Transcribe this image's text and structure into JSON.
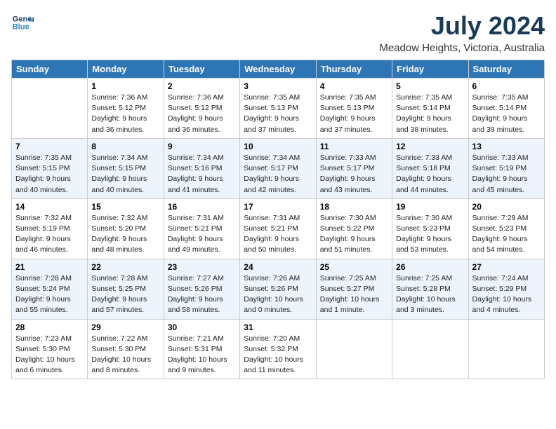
{
  "header": {
    "logo_line1": "General",
    "logo_line2": "Blue",
    "month_year": "July 2024",
    "location": "Meadow Heights, Victoria, Australia"
  },
  "weekdays": [
    "Sunday",
    "Monday",
    "Tuesday",
    "Wednesday",
    "Thursday",
    "Friday",
    "Saturday"
  ],
  "weeks": [
    [
      {
        "day": "",
        "sunrise": "",
        "sunset": "",
        "daylight": ""
      },
      {
        "day": "1",
        "sunrise": "Sunrise: 7:36 AM",
        "sunset": "Sunset: 5:12 PM",
        "daylight": "Daylight: 9 hours and 36 minutes."
      },
      {
        "day": "2",
        "sunrise": "Sunrise: 7:36 AM",
        "sunset": "Sunset: 5:12 PM",
        "daylight": "Daylight: 9 hours and 36 minutes."
      },
      {
        "day": "3",
        "sunrise": "Sunrise: 7:35 AM",
        "sunset": "Sunset: 5:13 PM",
        "daylight": "Daylight: 9 hours and 37 minutes."
      },
      {
        "day": "4",
        "sunrise": "Sunrise: 7:35 AM",
        "sunset": "Sunset: 5:13 PM",
        "daylight": "Daylight: 9 hours and 37 minutes."
      },
      {
        "day": "5",
        "sunrise": "Sunrise: 7:35 AM",
        "sunset": "Sunset: 5:14 PM",
        "daylight": "Daylight: 9 hours and 38 minutes."
      },
      {
        "day": "6",
        "sunrise": "Sunrise: 7:35 AM",
        "sunset": "Sunset: 5:14 PM",
        "daylight": "Daylight: 9 hours and 39 minutes."
      }
    ],
    [
      {
        "day": "7",
        "sunrise": "Sunrise: 7:35 AM",
        "sunset": "Sunset: 5:15 PM",
        "daylight": "Daylight: 9 hours and 40 minutes."
      },
      {
        "day": "8",
        "sunrise": "Sunrise: 7:34 AM",
        "sunset": "Sunset: 5:15 PM",
        "daylight": "Daylight: 9 hours and 40 minutes."
      },
      {
        "day": "9",
        "sunrise": "Sunrise: 7:34 AM",
        "sunset": "Sunset: 5:16 PM",
        "daylight": "Daylight: 9 hours and 41 minutes."
      },
      {
        "day": "10",
        "sunrise": "Sunrise: 7:34 AM",
        "sunset": "Sunset: 5:17 PM",
        "daylight": "Daylight: 9 hours and 42 minutes."
      },
      {
        "day": "11",
        "sunrise": "Sunrise: 7:33 AM",
        "sunset": "Sunset: 5:17 PM",
        "daylight": "Daylight: 9 hours and 43 minutes."
      },
      {
        "day": "12",
        "sunrise": "Sunrise: 7:33 AM",
        "sunset": "Sunset: 5:18 PM",
        "daylight": "Daylight: 9 hours and 44 minutes."
      },
      {
        "day": "13",
        "sunrise": "Sunrise: 7:33 AM",
        "sunset": "Sunset: 5:19 PM",
        "daylight": "Daylight: 9 hours and 45 minutes."
      }
    ],
    [
      {
        "day": "14",
        "sunrise": "Sunrise: 7:32 AM",
        "sunset": "Sunset: 5:19 PM",
        "daylight": "Daylight: 9 hours and 46 minutes."
      },
      {
        "day": "15",
        "sunrise": "Sunrise: 7:32 AM",
        "sunset": "Sunset: 5:20 PM",
        "daylight": "Daylight: 9 hours and 48 minutes."
      },
      {
        "day": "16",
        "sunrise": "Sunrise: 7:31 AM",
        "sunset": "Sunset: 5:21 PM",
        "daylight": "Daylight: 9 hours and 49 minutes."
      },
      {
        "day": "17",
        "sunrise": "Sunrise: 7:31 AM",
        "sunset": "Sunset: 5:21 PM",
        "daylight": "Daylight: 9 hours and 50 minutes."
      },
      {
        "day": "18",
        "sunrise": "Sunrise: 7:30 AM",
        "sunset": "Sunset: 5:22 PM",
        "daylight": "Daylight: 9 hours and 51 minutes."
      },
      {
        "day": "19",
        "sunrise": "Sunrise: 7:30 AM",
        "sunset": "Sunset: 5:23 PM",
        "daylight": "Daylight: 9 hours and 53 minutes."
      },
      {
        "day": "20",
        "sunrise": "Sunrise: 7:29 AM",
        "sunset": "Sunset: 5:23 PM",
        "daylight": "Daylight: 9 hours and 54 minutes."
      }
    ],
    [
      {
        "day": "21",
        "sunrise": "Sunrise: 7:28 AM",
        "sunset": "Sunset: 5:24 PM",
        "daylight": "Daylight: 9 hours and 55 minutes."
      },
      {
        "day": "22",
        "sunrise": "Sunrise: 7:28 AM",
        "sunset": "Sunset: 5:25 PM",
        "daylight": "Daylight: 9 hours and 57 minutes."
      },
      {
        "day": "23",
        "sunrise": "Sunrise: 7:27 AM",
        "sunset": "Sunset: 5:26 PM",
        "daylight": "Daylight: 9 hours and 58 minutes."
      },
      {
        "day": "24",
        "sunrise": "Sunrise: 7:26 AM",
        "sunset": "Sunset: 5:26 PM",
        "daylight": "Daylight: 10 hours and 0 minutes."
      },
      {
        "day": "25",
        "sunrise": "Sunrise: 7:25 AM",
        "sunset": "Sunset: 5:27 PM",
        "daylight": "Daylight: 10 hours and 1 minute."
      },
      {
        "day": "26",
        "sunrise": "Sunrise: 7:25 AM",
        "sunset": "Sunset: 5:28 PM",
        "daylight": "Daylight: 10 hours and 3 minutes."
      },
      {
        "day": "27",
        "sunrise": "Sunrise: 7:24 AM",
        "sunset": "Sunset: 5:29 PM",
        "daylight": "Daylight: 10 hours and 4 minutes."
      }
    ],
    [
      {
        "day": "28",
        "sunrise": "Sunrise: 7:23 AM",
        "sunset": "Sunset: 5:30 PM",
        "daylight": "Daylight: 10 hours and 6 minutes."
      },
      {
        "day": "29",
        "sunrise": "Sunrise: 7:22 AM",
        "sunset": "Sunset: 5:30 PM",
        "daylight": "Daylight: 10 hours and 8 minutes."
      },
      {
        "day": "30",
        "sunrise": "Sunrise: 7:21 AM",
        "sunset": "Sunset: 5:31 PM",
        "daylight": "Daylight: 10 hours and 9 minutes."
      },
      {
        "day": "31",
        "sunrise": "Sunrise: 7:20 AM",
        "sunset": "Sunset: 5:32 PM",
        "daylight": "Daylight: 10 hours and 11 minutes."
      },
      {
        "day": "",
        "sunrise": "",
        "sunset": "",
        "daylight": ""
      },
      {
        "day": "",
        "sunrise": "",
        "sunset": "",
        "daylight": ""
      },
      {
        "day": "",
        "sunrise": "",
        "sunset": "",
        "daylight": ""
      }
    ]
  ]
}
